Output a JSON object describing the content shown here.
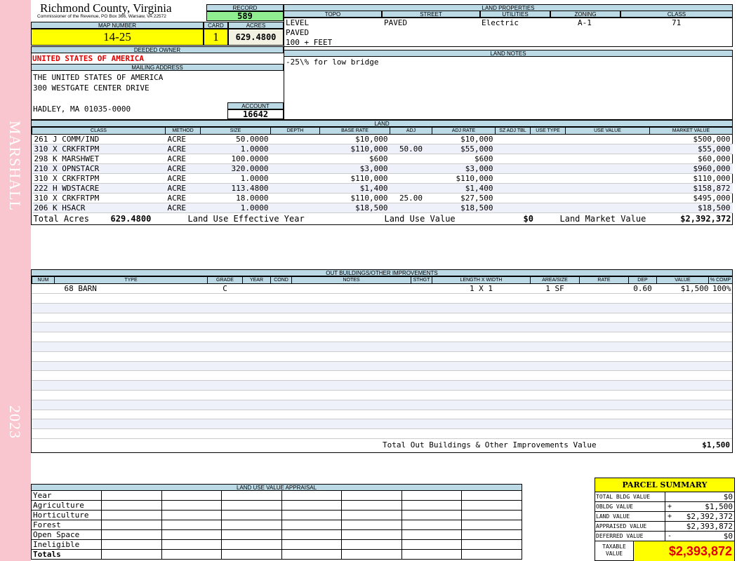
{
  "sidebar": {
    "top_text": "MARSHALL",
    "bottom_text": "2023",
    "color": "#f9c6cf"
  },
  "header": {
    "county": "Richmond County, Virginia",
    "commissioner": "Commissioner of the Revenue, PO Box 366, Warsaw, VA 22572",
    "record_label": "RECORD",
    "record_value": "589",
    "map_number_label": "MAP NUMBER",
    "map_number": "14-25",
    "card_label": "CARD",
    "card": "1",
    "acres_label": "ACRES",
    "acres": "629.4800",
    "deeded_owner_label": "DEEDED OWNER",
    "deeded_owner": "UNITED STATES OF AMERICA",
    "mailing_address_label": "MAILING ADDRESS",
    "mailing_line1": "THE UNITED STATES OF AMERICA",
    "mailing_line2": "300 WESTGATE CENTER DRIVE",
    "mailing_line3": "HADLEY, MA 01035-0000",
    "account_label": "ACCOUNT",
    "account": "16642"
  },
  "land_properties": {
    "title": "LAND PROPERTIES",
    "headers": [
      "TOPO",
      "STREET",
      "UTILITIES",
      "ZONING",
      "CLASS"
    ],
    "topo": [
      "LEVEL",
      "PAVED",
      "100 + FEET"
    ],
    "street": "PAVED",
    "utilities": "Electric",
    "zoning": "A-1",
    "class": "71"
  },
  "land_notes": {
    "title": "LAND NOTES",
    "text": "-25\\% for low bridge"
  },
  "land": {
    "title": "LAND",
    "headers": [
      "CLASS",
      "METHOD",
      "SIZE",
      "DEPTH",
      "BASE RATE",
      "ADJ",
      "ADJ RATE",
      "SZ ADJ TBL",
      "USE TYPE",
      "USE VALUE",
      "MARKET VALUE"
    ],
    "rows": [
      {
        "cls": "261 J COMM/IND",
        "method": "ACRE",
        "size": "50.0000",
        "base": "$10,000",
        "adj": "",
        "adj_rate": "$10,000",
        "market": "$500,000"
      },
      {
        "cls": "310 X CRKFRTPM",
        "method": "ACRE",
        "size": "1.0000",
        "base": "$110,000",
        "adj": "50.00",
        "adj_rate": "$55,000",
        "market": "$55,000"
      },
      {
        "cls": "298 K MARSHWET",
        "method": "ACRE",
        "size": "100.0000",
        "base": "$600",
        "adj": "",
        "adj_rate": "$600",
        "market": "$60,000"
      },
      {
        "cls": "210 X OPNSTACR",
        "method": "ACRE",
        "size": "320.0000",
        "base": "$3,000",
        "adj": "",
        "adj_rate": "$3,000",
        "market": "$960,000"
      },
      {
        "cls": "310 X CRKFRTPM",
        "method": "ACRE",
        "size": "1.0000",
        "base": "$110,000",
        "adj": "",
        "adj_rate": "$110,000",
        "market": "$110,000"
      },
      {
        "cls": "222 H WDSTACRE",
        "method": "ACRE",
        "size": "113.4800",
        "base": "$1,400",
        "adj": "",
        "adj_rate": "$1,400",
        "market": "$158,872"
      },
      {
        "cls": "310 X CRKFRTPM",
        "method": "ACRE",
        "size": "18.0000",
        "base": "$110,000",
        "adj": "25.00",
        "adj_rate": "$27,500",
        "market": "$495,000"
      },
      {
        "cls": "206 K HSACR",
        "method": "ACRE",
        "size": "1.0000",
        "base": "$18,500",
        "adj": "",
        "adj_rate": "$18,500",
        "market": "$18,500"
      }
    ],
    "total_acres_label": "Total Acres",
    "total_acres": "629.4800",
    "effective_year_label": "Land Use Effective Year",
    "use_value_label": "Land Use Value",
    "use_value": "$0",
    "market_value_label": "Land Market Value",
    "market_value": "$2,392,372"
  },
  "outbuildings": {
    "title": "OUT BUILDINGS/OTHER IMPROVEMENTS",
    "headers": [
      "NUM",
      "TYPE",
      "GRADE",
      "YEAR",
      "COND",
      "NOTES",
      "STHGT",
      "LENGTH X WIDTH",
      "AREA/SIZE",
      "RATE",
      "DEP",
      "VALUE",
      "% COMP"
    ],
    "row": {
      "type": "68 BARN",
      "grade": "C",
      "lw": "1 X 1",
      "area": "1 SF",
      "dep": "0.60",
      "value": "$1,500",
      "comp": "100%"
    },
    "total_label": "Total Out Buildings & Other Improvements Value",
    "total": "$1,500"
  },
  "luv": {
    "title": "LAND USE VALUE APPRAISAL",
    "rows": [
      "Year",
      "Agriculture",
      "Horticulture",
      "Forest",
      "Open Space",
      "Ineligible",
      "Totals"
    ]
  },
  "parcel_summary": {
    "title": "PARCEL SUMMARY",
    "rows": [
      {
        "label": "TOTAL BLDG VALUE",
        "sign": "",
        "value": "$0"
      },
      {
        "label": "OBLDG VALUE",
        "sign": "+",
        "value": "$1,500"
      },
      {
        "label": "LAND VALUE",
        "sign": "+",
        "value": "$2,392,372"
      },
      {
        "label": "APPRAISED VALUE",
        "sign": "",
        "value": "$2,393,872"
      },
      {
        "label": "DEFERRED VALUE",
        "sign": "-",
        "value": "$0"
      }
    ],
    "taxable_label_1": "TAXABLE",
    "taxable_label_2": "VALUE",
    "taxable_value": "$2,393,872",
    "highlight_color": "#ffff00"
  }
}
